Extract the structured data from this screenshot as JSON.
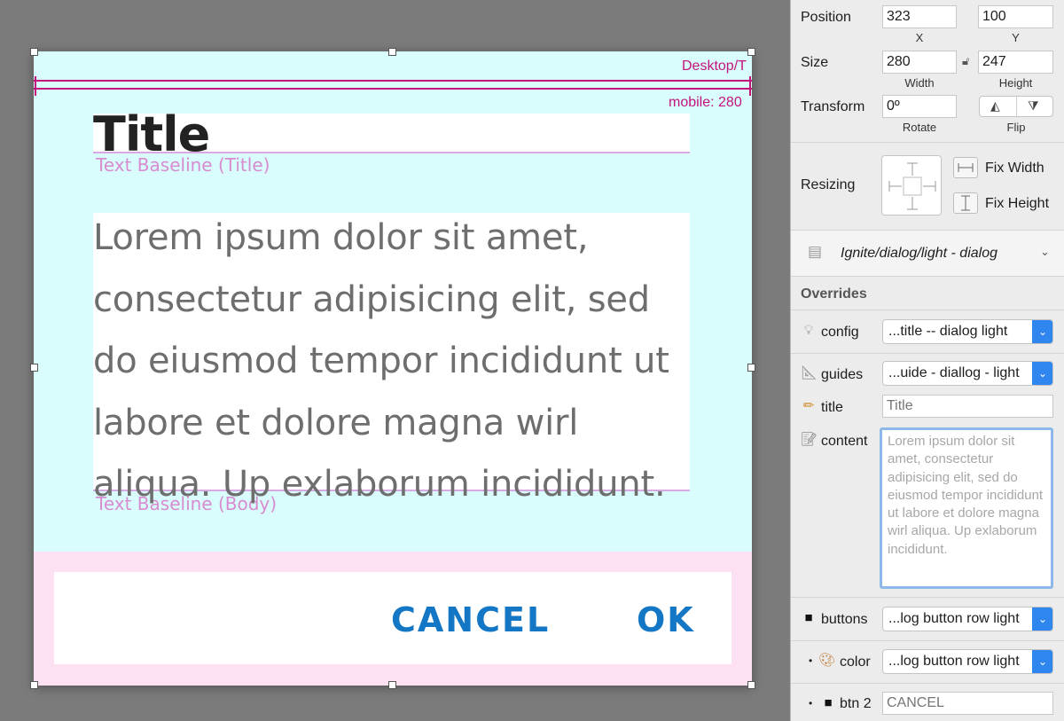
{
  "artboard": {
    "guide_desktop": "Desktop/T",
    "guide_mobile": "mobile: 280",
    "title": "Title",
    "title_baseline": "Text Baseline (Title)",
    "body": "Lorem ipsum dolor sit amet, consectetur adipisicing elit, sed do eiusmod tempor incididunt ut labore et dolore magna wirl aliqua. Up exlaborum incididunt.",
    "body_baseline": "Text Baseline (Body)",
    "cancel": "CANCEL",
    "ok": "OK"
  },
  "inspector": {
    "position": {
      "label": "Position",
      "x": "323",
      "y": "100",
      "x_label": "X",
      "y_label": "Y"
    },
    "size": {
      "label": "Size",
      "width": "280",
      "height": "247",
      "width_label": "Width",
      "height_label": "Height"
    },
    "transform": {
      "label": "Transform",
      "rotate": "0º",
      "rotate_label": "Rotate",
      "flip_label": "Flip"
    },
    "resizing": {
      "label": "Resizing",
      "fix_width": "Fix Width",
      "fix_height": "Fix Height"
    },
    "symbol": {
      "name": "Ignite/dialog/light - dialog"
    },
    "overrides": {
      "heading": "Overrides",
      "config": {
        "label": "config",
        "value": "...title -- dialog light"
      },
      "guides": {
        "label": "guides",
        "value": "...uide - diallog - light"
      },
      "title": {
        "label": "title",
        "placeholder": "Title"
      },
      "content": {
        "label": "content",
        "placeholder": "Lorem ipsum dolor sit amet, consectetur adipisicing elit, sed do eiusmod tempor incididunt ut labore et dolore magna wirl aliqua. Up exlaborum incididunt."
      },
      "buttons": {
        "label": "buttons",
        "value": "...log button row light"
      },
      "color": {
        "label": "color",
        "value": "...log button row light"
      },
      "btn2": {
        "label": "btn 2",
        "placeholder": "CANCEL"
      }
    }
  }
}
